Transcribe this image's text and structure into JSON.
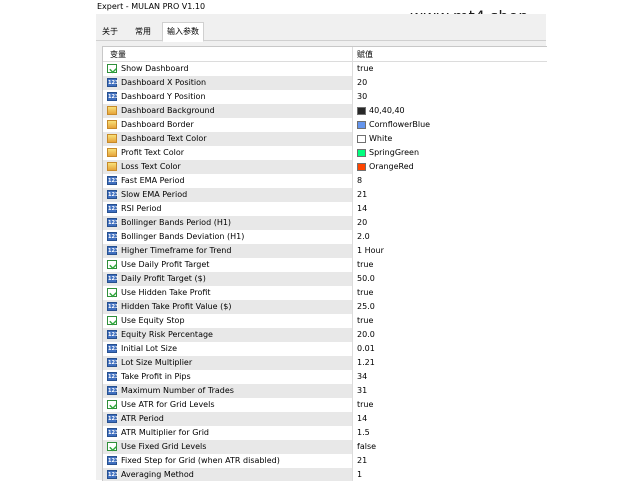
{
  "window": {
    "title": "Expert - MULAN PRO V1.10"
  },
  "watermark": "www.mt4.shop",
  "tabs": [
    {
      "label": "关于"
    },
    {
      "label": "常用"
    },
    {
      "label": "输入参数",
      "active": true
    }
  ],
  "grid": {
    "header": {
      "variable": "变量",
      "value": "赋值"
    },
    "rows": [
      {
        "icon": "bool",
        "name": "Show Dashboard",
        "value": "true"
      },
      {
        "icon": "ab",
        "name": "Dashboard X Position",
        "value": "20"
      },
      {
        "icon": "ab",
        "name": "Dashboard Y Position",
        "value": "30"
      },
      {
        "icon": "color",
        "name": "Dashboard Background",
        "value": "40,40,40",
        "swatch": "#282828"
      },
      {
        "icon": "color",
        "name": "Dashboard Border",
        "value": "CornflowerBlue",
        "swatch": "#6495ED"
      },
      {
        "icon": "color",
        "name": "Dashboard Text Color",
        "value": "White",
        "swatch": "#FFFFFF"
      },
      {
        "icon": "color",
        "name": "Profit Text Color",
        "value": "SpringGreen",
        "swatch": "#00FF7F"
      },
      {
        "icon": "color",
        "name": "Loss Text Color",
        "value": "OrangeRed",
        "swatch": "#FF4500"
      },
      {
        "icon": "ab",
        "name": "Fast EMA Period",
        "value": "8"
      },
      {
        "icon": "ab",
        "name": "Slow EMA Period",
        "value": "21"
      },
      {
        "icon": "ab",
        "name": "RSI Period",
        "value": "14"
      },
      {
        "icon": "ab",
        "name": "Bollinger Bands Period (H1)",
        "value": "20"
      },
      {
        "icon": "ab",
        "name": "Bollinger Bands Deviation (H1)",
        "value": "2.0"
      },
      {
        "icon": "ab",
        "name": "Higher Timeframe for Trend",
        "value": "1 Hour"
      },
      {
        "icon": "bool",
        "name": "Use Daily Profit Target",
        "value": "true"
      },
      {
        "icon": "ab",
        "name": "Daily Profit Target ($)",
        "value": "50.0"
      },
      {
        "icon": "bool",
        "name": "Use Hidden Take Profit",
        "value": "true"
      },
      {
        "icon": "ab",
        "name": "Hidden Take Profit Value ($)",
        "value": "25.0"
      },
      {
        "icon": "bool",
        "name": "Use Equity Stop",
        "value": "true"
      },
      {
        "icon": "ab",
        "name": "Equity Risk Percentage",
        "value": "20.0"
      },
      {
        "icon": "ab",
        "name": "Initial Lot Size",
        "value": "0.01"
      },
      {
        "icon": "ab",
        "name": "Lot Size Multiplier",
        "value": "1.21"
      },
      {
        "icon": "ab",
        "name": "Take Profit in Pips",
        "value": "34"
      },
      {
        "icon": "ab",
        "name": "Maximum Number of Trades",
        "value": "31"
      },
      {
        "icon": "bool",
        "name": "Use ATR for Grid Levels",
        "value": "true"
      },
      {
        "icon": "ab",
        "name": "ATR Period",
        "value": "14"
      },
      {
        "icon": "ab",
        "name": "ATR Multiplier for Grid",
        "value": "1.5"
      },
      {
        "icon": "bool",
        "name": "Use Fixed Grid Levels",
        "value": "false"
      },
      {
        "icon": "ab",
        "name": "Fixed Step for Grid (when ATR disabled)",
        "value": "21"
      },
      {
        "icon": "ab",
        "name": "Averaging Method",
        "value": "1"
      }
    ]
  }
}
